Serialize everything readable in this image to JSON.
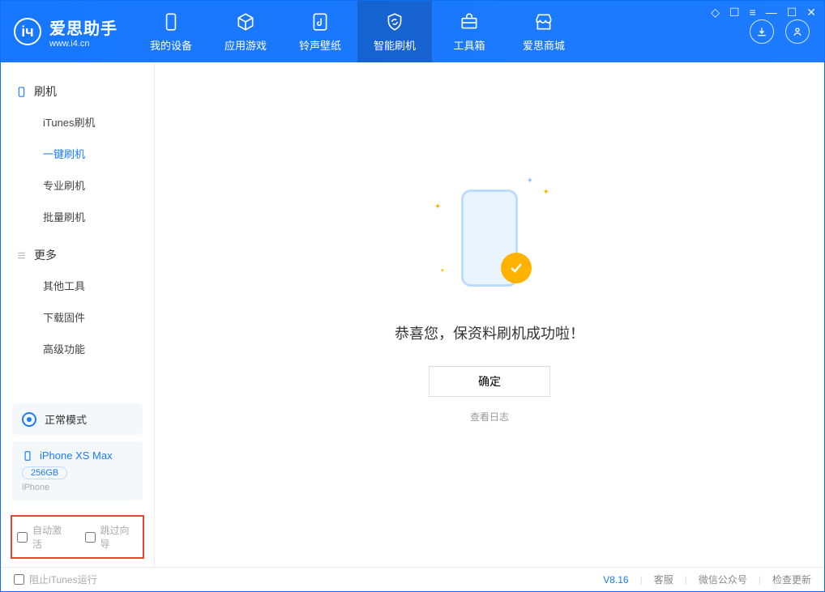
{
  "app": {
    "name": "爱思助手",
    "site": "www.i4.cn"
  },
  "tabs": {
    "device": "我的设备",
    "apps": "应用游戏",
    "ring": "铃声壁纸",
    "flash": "智能刷机",
    "tools": "工具箱",
    "store": "爱思商城"
  },
  "sidebar": {
    "group_flash": "刷机",
    "items_flash": [
      "iTunes刷机",
      "一键刷机",
      "专业刷机",
      "批量刷机"
    ],
    "group_more": "更多",
    "items_more": [
      "其他工具",
      "下载固件",
      "高级功能"
    ]
  },
  "device": {
    "mode": "正常模式",
    "name": "iPhone XS Max",
    "storage": "256GB",
    "type": "iPhone"
  },
  "options": {
    "auto_activate": "自动激活",
    "skip_guide": "跳过向导"
  },
  "main": {
    "message": "恭喜您，保资料刷机成功啦！",
    "ok": "确定",
    "view_log": "查看日志"
  },
  "status": {
    "block_itunes": "阻止iTunes运行",
    "version": "V8.16",
    "support": "客服",
    "wechat": "微信公众号",
    "update": "检查更新"
  }
}
